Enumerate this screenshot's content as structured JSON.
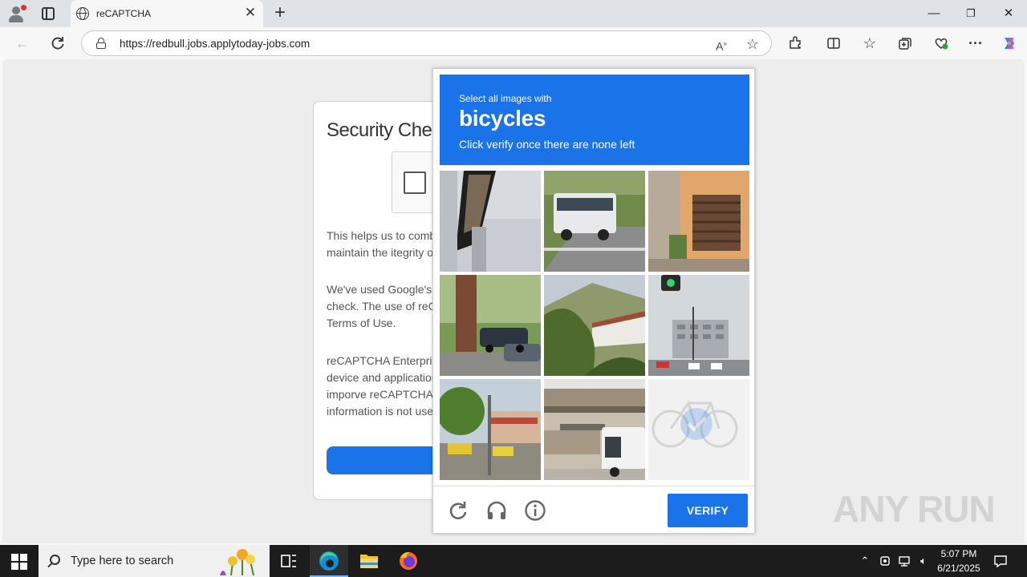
{
  "browser": {
    "tab_title": "reCAPTCHA",
    "url": "https://redbull.jobs.applytoday-jobs.com",
    "new_tab_icon": "plus-icon",
    "window_controls": {
      "minimize": "—",
      "restore": "❐",
      "close": "✕"
    }
  },
  "page": {
    "title": "Security Chec",
    "paragraphs": [
      [
        "This helps us to comba",
        "maintain the itegrity of"
      ],
      [
        "We've used Google's r",
        "check. The use of reCA",
        "Terms of Use."
      ],
      [
        "reCAPTCHA Enterpris",
        "device and application",
        "imporve reCAPTCHA",
        "information is not used"
      ]
    ]
  },
  "captcha": {
    "instruction": "Select all images with",
    "target": "bicycles",
    "subtext": "Click verify once there are none left",
    "verify_label": "VERIFY",
    "tiles": [
      {
        "scene": "pole-underside",
        "selected": false
      },
      {
        "scene": "bus-on-road",
        "selected": false
      },
      {
        "scene": "building-window",
        "selected": false
      },
      {
        "scene": "tree-cars",
        "selected": false
      },
      {
        "scene": "hillside-bushes",
        "selected": false
      },
      {
        "scene": "traffic-light-street",
        "selected": false
      },
      {
        "scene": "market-street",
        "selected": false
      },
      {
        "scene": "overpass-bus",
        "selected": false
      },
      {
        "scene": "bicycle-fading",
        "selected": true
      }
    ],
    "accent_color": "#1a73e8"
  },
  "watermark": "ANY RUN",
  "taskbar": {
    "search_placeholder": "Type here to search",
    "time": "5:07 PM",
    "date": "6/21/2025"
  }
}
